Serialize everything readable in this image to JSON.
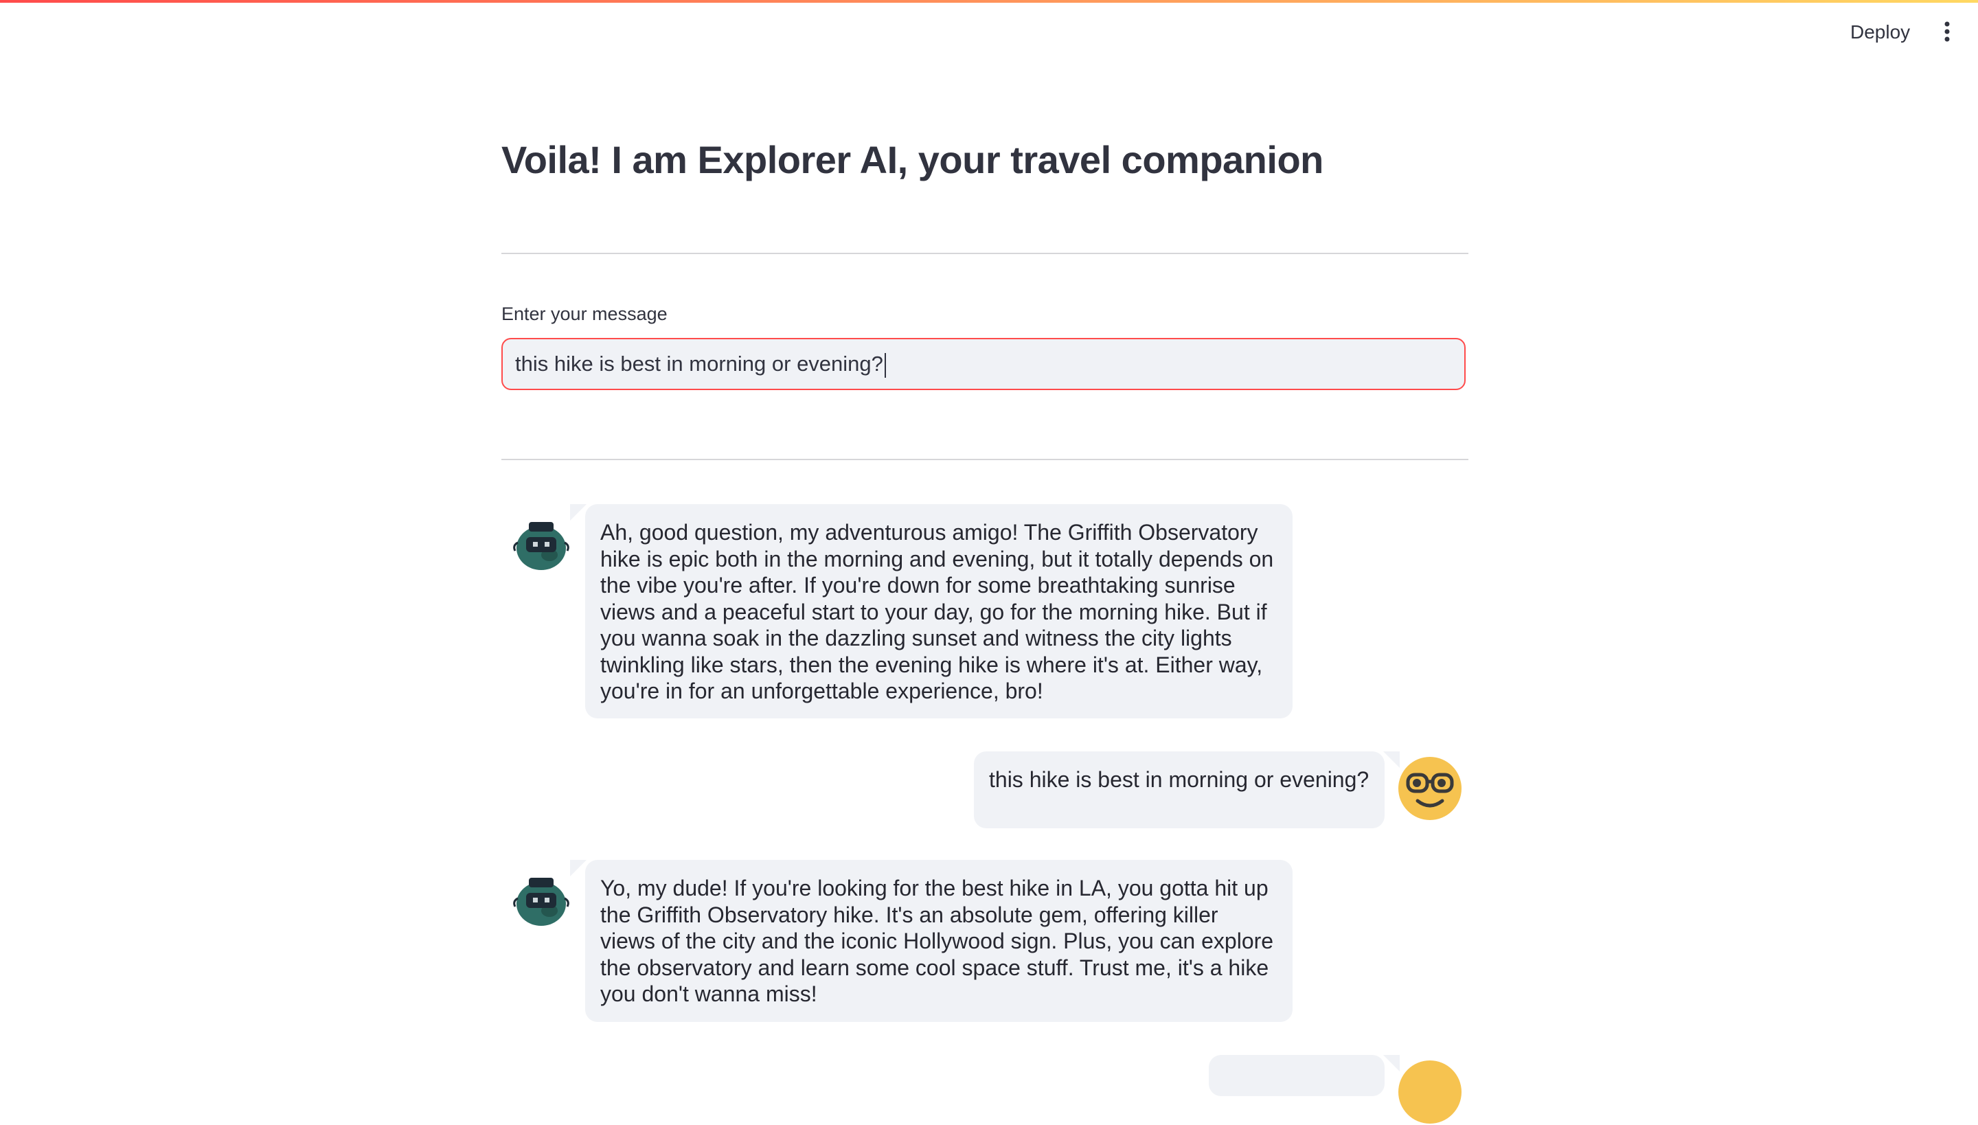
{
  "header": {
    "deploy_label": "Deploy",
    "menu_icon": "vertical-ellipsis-icon"
  },
  "page": {
    "title": "Voila! I am Explorer AI, your travel companion"
  },
  "input": {
    "label": "Enter your message",
    "value": "this hike is best in morning or evening?"
  },
  "messages": [
    {
      "role": "assistant",
      "avatar_icon": "robot-avatar-icon",
      "text": "Ah, good question, my adventurous amigo! The Griffith Observatory hike is epic both in the morning and evening, but it totally depends on the vibe you're after. If you're down for some breathtaking sunrise views and a peaceful start to your day, go for the morning hike. But if you wanna soak in the dazzling sunset and witness the city lights twinkling like stars, then the evening hike is where it's at. Either way, you're in for an unforgettable experience, bro!"
    },
    {
      "role": "user",
      "avatar_icon": "nerd-face-avatar-icon",
      "text": "this hike is best in morning or evening?"
    },
    {
      "role": "assistant",
      "avatar_icon": "robot-avatar-icon",
      "text": "Yo, my dude! If you're looking for the best hike in LA, you gotta hit up the Griffith Observatory hike. It's an absolute gem, offering killer views of the city and the iconic Hollywood sign. Plus, you can explore the observatory and learn some cool space stuff. Trust me, it's a hike you don't wanna miss!"
    },
    {
      "role": "user",
      "avatar_icon": "nerd-face-avatar-icon",
      "text": ""
    }
  ],
  "colors": {
    "accent": "#ff4b4b",
    "bubble_bg": "#f0f2f6",
    "text": "#31333f",
    "user_avatar": "#f6c350",
    "bot_avatar": "#2f6e66"
  }
}
